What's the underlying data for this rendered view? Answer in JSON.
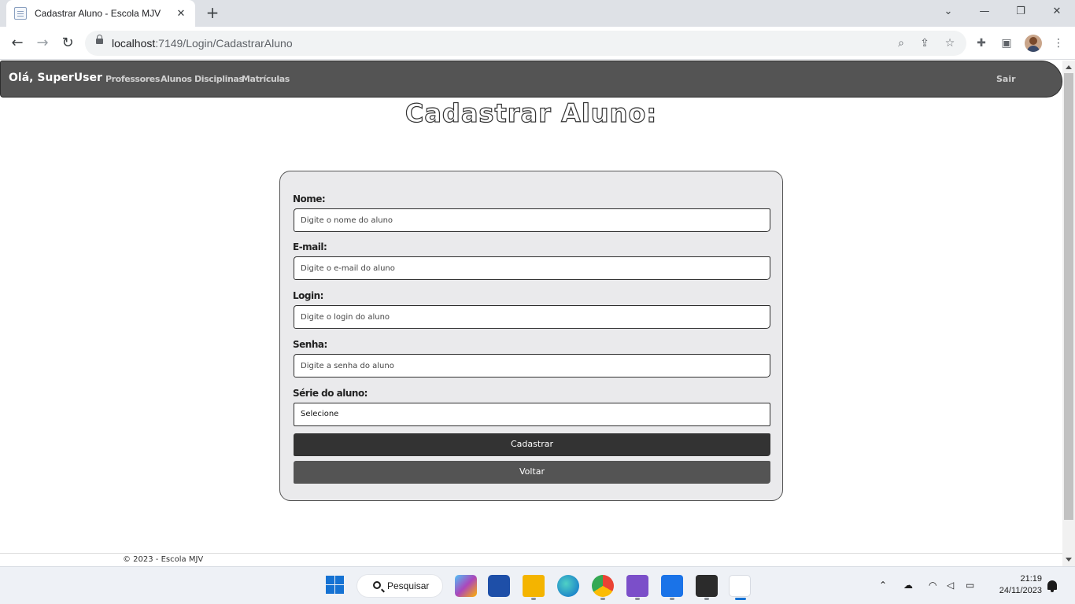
{
  "browser": {
    "tab_title": "Cadastrar Aluno - Escola MJV",
    "url_host": "localhost",
    "url_path": ":7149/Login/CadastrarAluno",
    "tab_close_glyph": "✕",
    "new_tab_glyph": "+"
  },
  "navbar": {
    "greeting": "Olá, SuperUser",
    "links": [
      "Professores",
      "Alunos",
      "Disciplinas",
      "Matrículas"
    ],
    "logout": "Sair"
  },
  "page": {
    "title": "Cadastrar Aluno:"
  },
  "form": {
    "fields": [
      {
        "label": "Nome:",
        "placeholder": "Digite o nome do aluno"
      },
      {
        "label": "E-mail:",
        "placeholder": "Digite o e-mail do aluno"
      },
      {
        "label": "Login:",
        "placeholder": "Digite o login do aluno"
      },
      {
        "label": "Senha:",
        "placeholder": "Digite a senha do aluno"
      }
    ],
    "serie_label": "Série do aluno:",
    "serie_selected": "Selecione",
    "submit_label": "Cadastrar",
    "back_label": "Voltar"
  },
  "footer": {
    "text": "© 2023 - Escola MJV"
  },
  "taskbar": {
    "search_label": "Pesquisar",
    "time": "21:19",
    "date": "24/11/2023"
  },
  "colors": {
    "navbar_bg": "#545454",
    "card_bg": "#eaeaec",
    "primary_button": "#333333",
    "secondary_button": "#545454"
  }
}
